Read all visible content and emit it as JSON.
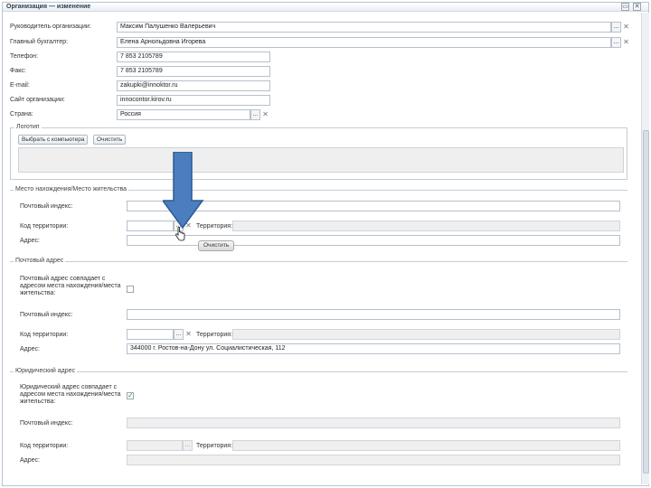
{
  "window": {
    "title": "Организация — изменение",
    "minimize_glyph": "▭",
    "close_glyph": "✕"
  },
  "fields": {
    "director": {
      "label": "Руководитель организации:",
      "value": "Максим Палушенко Валерьевич"
    },
    "accountant": {
      "label": "Главный бухгалтер:",
      "value": "Елена Арнольдовна Игорева"
    },
    "phone": {
      "label": "Телефон:",
      "value": "7 853 2105789"
    },
    "fax": {
      "label": "Факс:",
      "value": "7 853 2105789"
    },
    "email": {
      "label": "E-mail:",
      "value": "zakupki@innoktor.ru"
    },
    "site": {
      "label": "Сайт организации:",
      "value": "innocontor.kirov.ru"
    },
    "country": {
      "label": "Страна:",
      "value": "Россия"
    }
  },
  "lookup_glyph": "...",
  "clear_glyph": "✕",
  "combo_glyph": "▾",
  "logo_section": {
    "legend": "Логотип",
    "choose_button": "Выбрать с компьютера",
    "clear_button": "Очистить"
  },
  "residence": {
    "legend": "Место нахождения/Место жительства",
    "postal_index_label": "Почтовый индекс:",
    "territory_code_label": "Код территории:",
    "territory_label": "Территория:",
    "address_label": "Адрес:",
    "tooltip": "Очистить"
  },
  "postal": {
    "legend": "Почтовый адрес",
    "same_label": "Почтовый адрес совпадает с адресом места нахождения/места жительства:",
    "postal_index_label": "Почтовый индекс:",
    "territory_code_label": "Код территории:",
    "territory_label": "Территория:",
    "address_label": "Адрес:",
    "address_value": "344000 г. Ростов-на-Дону ул. Социалистическая, 112"
  },
  "legal": {
    "legend": "Юридический адрес",
    "same_label": "Юридический адрес совпадает с адресом места нахождения/места жительства:",
    "checked_glyph": "✓",
    "postal_index_label": "Почтовый индекс:",
    "territory_code_label": "Код территории:",
    "territory_label": "Территория:",
    "address_label": "Адрес:"
  },
  "colors": {
    "arrow_fill": "#4a7ebf",
    "arrow_stroke": "#2f5a8f"
  }
}
